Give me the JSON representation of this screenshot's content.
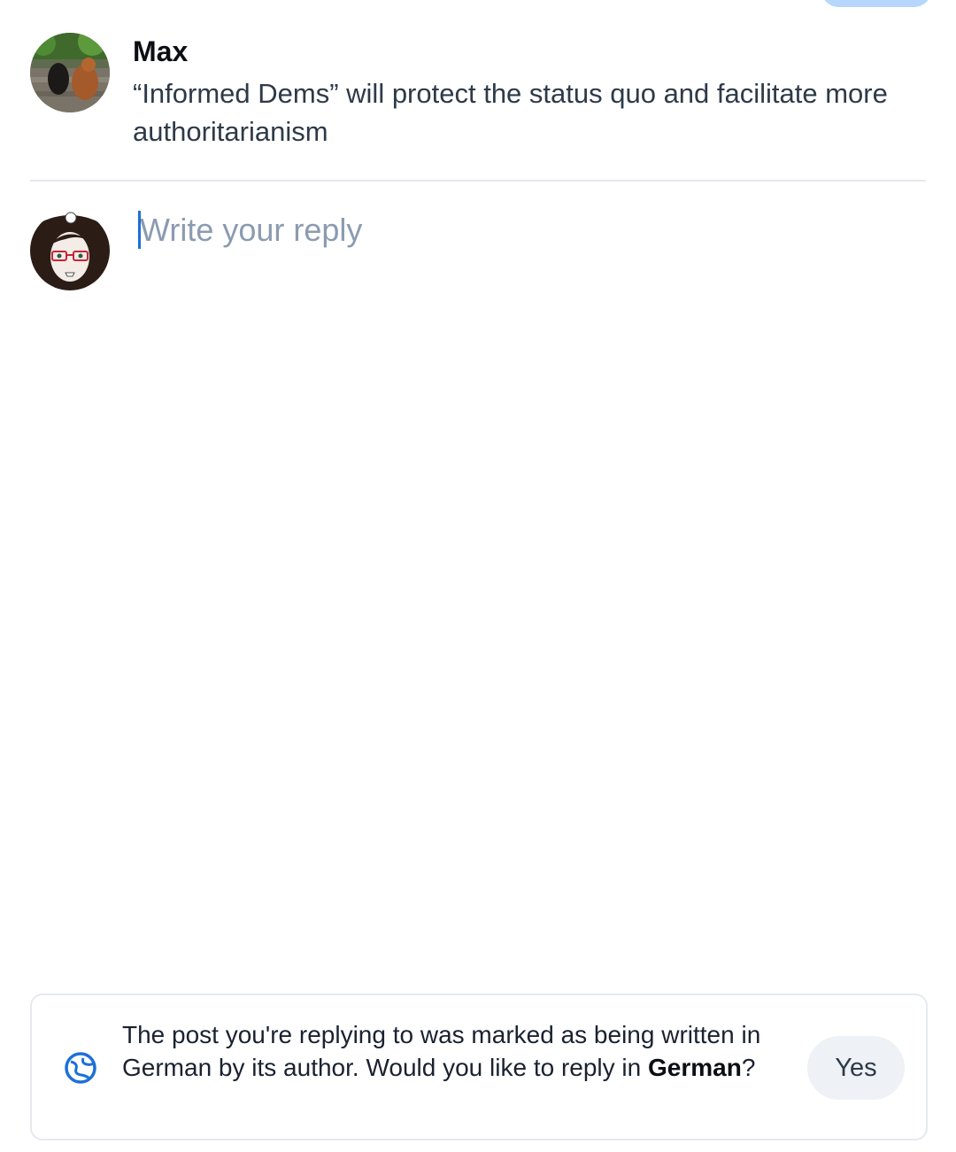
{
  "parent_post": {
    "author_name": "Max",
    "text": "“Informed Dems” will protect the status quo and facilitate more authoritarianism"
  },
  "composer": {
    "placeholder": "Write your reply",
    "value": ""
  },
  "language_prompt": {
    "icon": "globe-icon",
    "message_prefix": "The post you're replying to was marked as being written in German by its author. Would you like to reply in ",
    "language": "German",
    "message_suffix": "?",
    "yes_label": "Yes"
  },
  "colors": {
    "accent": "#1c6fd8",
    "placeholder": "#8b9bb0",
    "pill": "#b7d6fb"
  }
}
